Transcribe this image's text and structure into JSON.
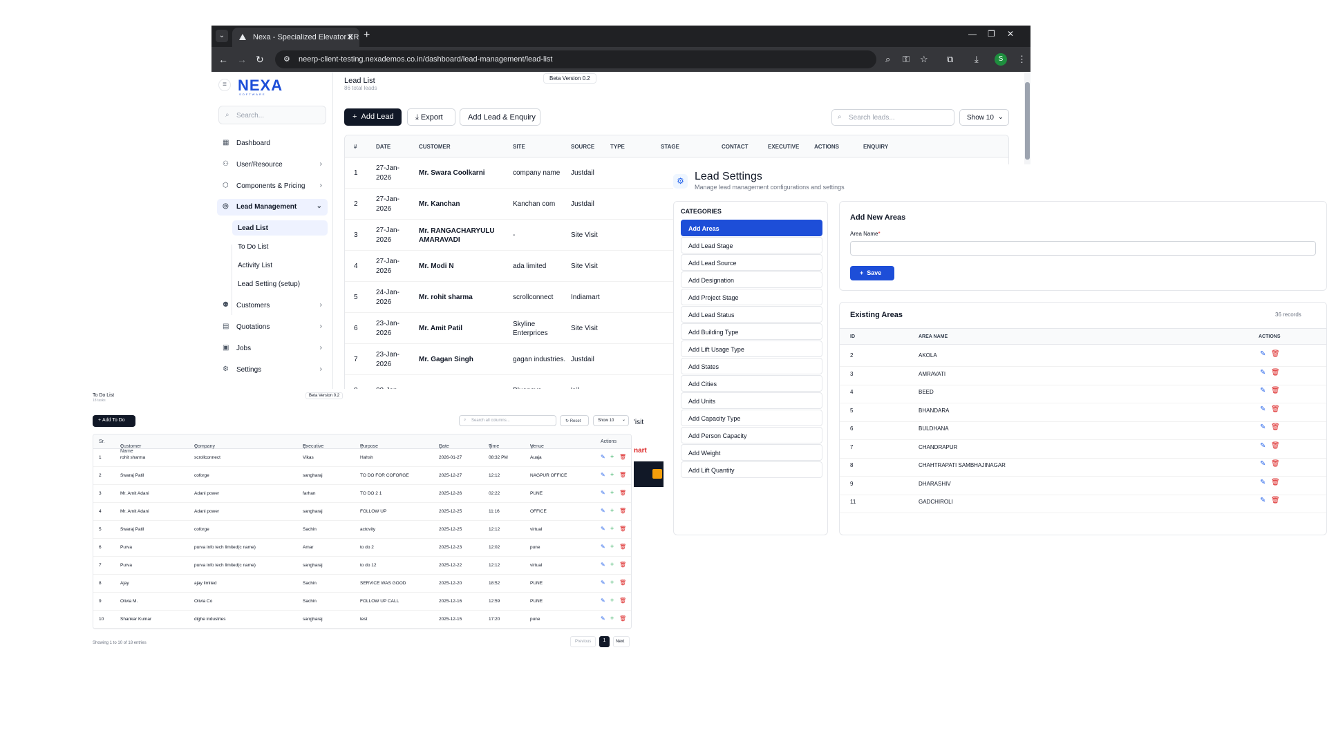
{
  "browser": {
    "tab_title": "Nexa - Specialized Elevator ERP",
    "url": "neerp-client-testing.nexademos.co.in/dashboard/lead-management/lead-list",
    "profile_initial": "S"
  },
  "sidebar": {
    "logo": "NEXA",
    "logo_sub": "SOFTWARE",
    "search_placeholder": "Search...",
    "items": [
      {
        "label": "Dashboard"
      },
      {
        "label": "User/Resource"
      },
      {
        "label": "Components & Pricing"
      },
      {
        "label": "Lead Management"
      },
      {
        "label": "Customers"
      },
      {
        "label": "Quotations"
      },
      {
        "label": "Jobs"
      },
      {
        "label": "Settings"
      }
    ],
    "sub_items": [
      {
        "label": "Lead List"
      },
      {
        "label": "To Do List"
      },
      {
        "label": "Activity List"
      },
      {
        "label": "Lead Setting (setup)"
      }
    ]
  },
  "lead_list": {
    "title": "Lead List",
    "subtitle": "86 total leads",
    "beta": "Beta Version 0.2",
    "add_lead": "Add Lead",
    "export": "Export",
    "add_lead_enquiry": "Add Lead & Enquiry",
    "search_placeholder": "Search leads...",
    "show": "Show 10",
    "columns": [
      "#",
      "DATE",
      "CUSTOMER",
      "SITE",
      "SOURCE",
      "TYPE",
      "STAGE",
      "CONTACT",
      "EXECUTIVE",
      "ACTIONS",
      "ENQUIRY"
    ],
    "rows": [
      {
        "n": "1",
        "date1": "27-Jan-",
        "date2": "2026",
        "customer": "Mr. Swara Coolkarni",
        "customer2": "",
        "site": "company name",
        "site2": "",
        "source": "Justdail"
      },
      {
        "n": "2",
        "date1": "27-Jan-",
        "date2": "2026",
        "customer": "Mr. Kanchan",
        "customer2": "",
        "site": "Kanchan com",
        "site2": "",
        "source": "Justdail"
      },
      {
        "n": "3",
        "date1": "27-Jan-",
        "date2": "2026",
        "customer": "Mr. RANGACHARYULU",
        "customer2": "AMARAVADI",
        "site": "-",
        "site2": "",
        "source": "Site Visit"
      },
      {
        "n": "4",
        "date1": "27-Jan-",
        "date2": "2026",
        "customer": "Mr. Modi N",
        "customer2": "",
        "site": "ada limited",
        "site2": "",
        "source": "Site Visit"
      },
      {
        "n": "5",
        "date1": "24-Jan-",
        "date2": "2026",
        "customer": "Mr. rohit sharma",
        "customer2": "",
        "site": "scrollconnect",
        "site2": "",
        "source": "Indiamart"
      },
      {
        "n": "6",
        "date1": "23-Jan-",
        "date2": "2026",
        "customer": "Mr. Amit Patil",
        "customer2": "",
        "site": "Skyline",
        "site2": "Enterprices",
        "source": "Site Visit"
      },
      {
        "n": "7",
        "date1": "23-Jan-",
        "date2": "2026",
        "customer": "Mr. Gagan Singh",
        "customer2": "",
        "site": "gagan industries.",
        "site2": "",
        "source": "Justdail"
      },
      {
        "n": "8",
        "date1": "23-Jan-",
        "date2": "",
        "customer": "",
        "customer2": "",
        "site": "Bluenova",
        "site2": "",
        "source": "'ail"
      }
    ],
    "peek_visit": "'isit",
    "peek_mart": "nart"
  },
  "lead_settings": {
    "title": "Lead Settings",
    "subtitle": "Manage lead management configurations and settings",
    "categories_label": "CATEGORIES",
    "categories": [
      "Add Areas",
      "Add Lead Stage",
      "Add Lead Source",
      "Add Designation",
      "Add Project Stage",
      "Add Lead Status",
      "Add Building Type",
      "Add Lift Usage Type",
      "Add States",
      "Add Cities",
      "Add Units",
      "Add Capacity Type",
      "Add Person Capacity",
      "Add Weight",
      "Add Lift Quantity"
    ],
    "add_title": "Add New Areas",
    "area_name_label": "Area Name",
    "required_mark": "*",
    "save": "Save",
    "existing_title": "Existing Areas",
    "records": "36 records",
    "columns": [
      "ID",
      "AREA NAME",
      "ACTIONS"
    ],
    "areas": [
      {
        "id": "2",
        "name": "AKOLA"
      },
      {
        "id": "3",
        "name": "AMRAVATI"
      },
      {
        "id": "4",
        "name": "BEED"
      },
      {
        "id": "5",
        "name": "BHANDARA"
      },
      {
        "id": "6",
        "name": "BULDHANA"
      },
      {
        "id": "7",
        "name": "CHANDRAPUR"
      },
      {
        "id": "8",
        "name": "CHAHTRAPATI SAMBHAJINAGAR"
      },
      {
        "id": "9",
        "name": "DHARASHIV"
      },
      {
        "id": "11",
        "name": "GADCHIROLI"
      }
    ]
  },
  "todo": {
    "title": "To Do List",
    "subtitle": "18 tasks",
    "beta": "Beta Version 0.2",
    "add": "Add To Do",
    "search_placeholder": "Search all columns...",
    "reset": "Reset",
    "show": "Show 10",
    "columns": [
      "Sr.",
      "Customer Name",
      "Company",
      "Executive",
      "Purpose",
      "Date",
      "Time",
      "Venue",
      "Actions"
    ],
    "rows": [
      {
        "sr": "1",
        "customer": "rohit sharma",
        "company": "scrollconnect",
        "exec": "Vikas",
        "purpose": "Hahsh",
        "date": "2026-01-27",
        "time": "08:32 PM",
        "venue": "Auaja"
      },
      {
        "sr": "2",
        "customer": "Swaraj Patil",
        "company": "coforge",
        "exec": "sangharaj",
        "purpose": "TO DO FOR COFORGE",
        "date": "2025-12-27",
        "time": "12:12",
        "venue": "NAGPUR OFFICE"
      },
      {
        "sr": "3",
        "customer": "Mr. Amit Adani",
        "company": "Adani power",
        "exec": "farhan",
        "purpose": "TO DO 2 1",
        "date": "2025-12-26",
        "time": "02:22",
        "venue": "PUNE"
      },
      {
        "sr": "4",
        "customer": "Mr. Amit Adani",
        "company": "Adani power",
        "exec": "sangharaj",
        "purpose": "FOLLOW UP",
        "date": "2025-12-25",
        "time": "11:16",
        "venue": "OFFICE"
      },
      {
        "sr": "5",
        "customer": "Swaraj Patil",
        "company": "coforge",
        "exec": "Sachin",
        "purpose": "actovity",
        "date": "2025-12-25",
        "time": "12:12",
        "venue": "virtual"
      },
      {
        "sr": "6",
        "customer": "Purva",
        "company": "purva info tech limited(c name)",
        "exec": "Amar",
        "purpose": "to do 2",
        "date": "2025-12-23",
        "time": "12:02",
        "venue": "pune"
      },
      {
        "sr": "7",
        "customer": "Purva",
        "company": "purva info tech limited(c name)",
        "exec": "sangharaj",
        "purpose": "to do 12",
        "date": "2025-12-22",
        "time": "12:12",
        "venue": "virtual"
      },
      {
        "sr": "8",
        "customer": "Ajay",
        "company": "ajay limited",
        "exec": "Sachin",
        "purpose": "SERVICE WAS GOOD",
        "date": "2025-12-20",
        "time": "18:52",
        "venue": "PUNE"
      },
      {
        "sr": "9",
        "customer": "Olivia M.",
        "company": "Olivia Co",
        "exec": "Sachin",
        "purpose": "FOLLOW UP CALL",
        "date": "2025-12-16",
        "time": "12:59",
        "venue": "PUNE"
      },
      {
        "sr": "10",
        "customer": "Shankar Kumar",
        "company": "dighe industries",
        "exec": "sangharaj",
        "purpose": "test",
        "date": "2025-12-15",
        "time": "17:20",
        "venue": "pune"
      }
    ],
    "footer": "Showing 1 to 10 of 18 entries",
    "prev": "Previous",
    "page": "1",
    "next": "Next"
  },
  "colors": {
    "accent": "#1d4ed8",
    "dark_button": "#111827",
    "danger": "#dc2626",
    "success": "#16a34a"
  }
}
